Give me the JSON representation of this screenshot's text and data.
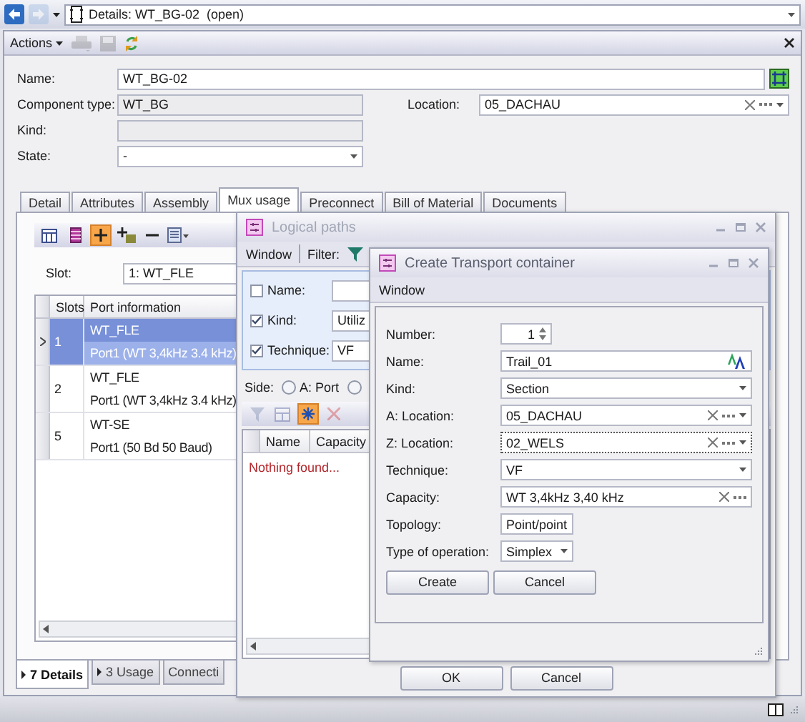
{
  "nav": {
    "back_enabled": true,
    "forward_enabled": false,
    "address": "Details: WT_BG-02  (open)"
  },
  "document": {
    "actions": "Actions",
    "print_enabled": false,
    "save_enabled": false,
    "rows": [
      {
        "label": "Name:",
        "kind": "text",
        "value": "WT_BG-02"
      },
      {
        "label": "Component type:",
        "kind": "readonly",
        "value": "WT_BG",
        "side": {
          "label": "Location:",
          "value": "05_DACHAU"
        }
      },
      {
        "label": "Kind:",
        "kind": "readonly"
      },
      {
        "label": "State:",
        "kind": "dropdown",
        "value": "-"
      }
    ],
    "tabs": [
      {
        "label": "Detail",
        "selected": false
      },
      {
        "label": "Attributes",
        "selected": false
      },
      {
        "label": "Assembly",
        "selected": false
      },
      {
        "label": "Mux usage",
        "selected": true
      },
      {
        "label": "Preconnect",
        "selected": false
      },
      {
        "label": "Bill of Material",
        "selected": false
      },
      {
        "label": "Documents",
        "selected": false
      }
    ],
    "toolbar": [
      {
        "kind": "columns",
        "active": false
      },
      {
        "kind": "rows",
        "active": false
      },
      {
        "kind": "add",
        "active": true
      },
      {
        "kind": "additem",
        "active": false
      },
      {
        "kind": "remove",
        "active": false
      },
      {
        "kind": "export",
        "active": false
      }
    ],
    "slot": {
      "label": "Slot:",
      "value": "1: WT_FLE"
    },
    "table": {
      "columns": [
        "Slots",
        "Port information"
      ],
      "rows": [
        {
          "slot": "1",
          "lines": [
            "WT_FLE",
            "Port1 (WT 3,4kHz 3.4 kHz)"
          ],
          "selected": true
        },
        {
          "slot": "2",
          "lines": [
            "WT_FLE",
            "Port1 (WT 3,4kHz 3.4 kHz)"
          ],
          "selected": false
        },
        {
          "slot": "5",
          "lines": [
            "WT-SE",
            "Port1 (50 Bd 50 Baud)"
          ],
          "selected": false
        }
      ]
    },
    "bottom_tabs": [
      {
        "label": "7 Details",
        "selected": true,
        "expandable": true
      },
      {
        "label": "3 Usage",
        "selected": false,
        "expandable": true
      },
      {
        "label": "Connecti",
        "selected": false,
        "expandable": false
      }
    ]
  },
  "logical_paths": {
    "title": "Logical paths",
    "active": false,
    "menu": "Window",
    "filter_label": "Filter:",
    "filters": [
      {
        "label": "Name:",
        "checked": false
      },
      {
        "label": "Kind:",
        "checked": true,
        "value": "Utiliz"
      },
      {
        "label": "Technique:",
        "checked": true,
        "value": "VF"
      }
    ],
    "side": {
      "label": "Side:",
      "options": [
        {
          "label": "A: Port",
          "selected": false
        },
        {
          "selected": false
        }
      ]
    },
    "tools": [
      {
        "kind": "filter",
        "enabled": false,
        "active": false
      },
      {
        "kind": "grid",
        "enabled": false,
        "active": false
      },
      {
        "kind": "snow",
        "enabled": true,
        "active": true
      },
      {
        "kind": "delete",
        "enabled": false,
        "active": false
      }
    ],
    "columns": [
      "Name",
      "Capacity"
    ],
    "empty_text": "Nothing found...",
    "buttons": [
      "OK",
      "Cancel"
    ]
  },
  "create_window": {
    "title": "Create Transport container",
    "active": true,
    "menu": "Window",
    "fields": [
      {
        "label": "Number:",
        "kind": "number",
        "value": "1",
        "focused": false
      },
      {
        "label": "Name:",
        "kind": "text",
        "value": "Trail_01",
        "focused": false
      },
      {
        "label": "Kind:",
        "kind": "dropdown",
        "value": "Section",
        "focused": false
      },
      {
        "label": "A: Location:",
        "kind": "lookup",
        "value": "05_DACHAU",
        "focused": false
      },
      {
        "label": "Z: Location:",
        "kind": "lookup",
        "value": "02_WELS",
        "focused": true
      },
      {
        "label": "Technique:",
        "kind": "dropdown",
        "value": "VF",
        "focused": false
      },
      {
        "label": "Capacity:",
        "kind": "picker",
        "value": "WT 3,4kHz 3,40 kHz",
        "focused": false
      },
      {
        "label": "Topology:",
        "kind": "compact",
        "value": "Point/point",
        "focused": false
      },
      {
        "label": "Type of operation:",
        "kind": "compact",
        "value": "Simplex",
        "focused": false
      }
    ],
    "buttons": [
      "Create",
      "Cancel"
    ]
  }
}
